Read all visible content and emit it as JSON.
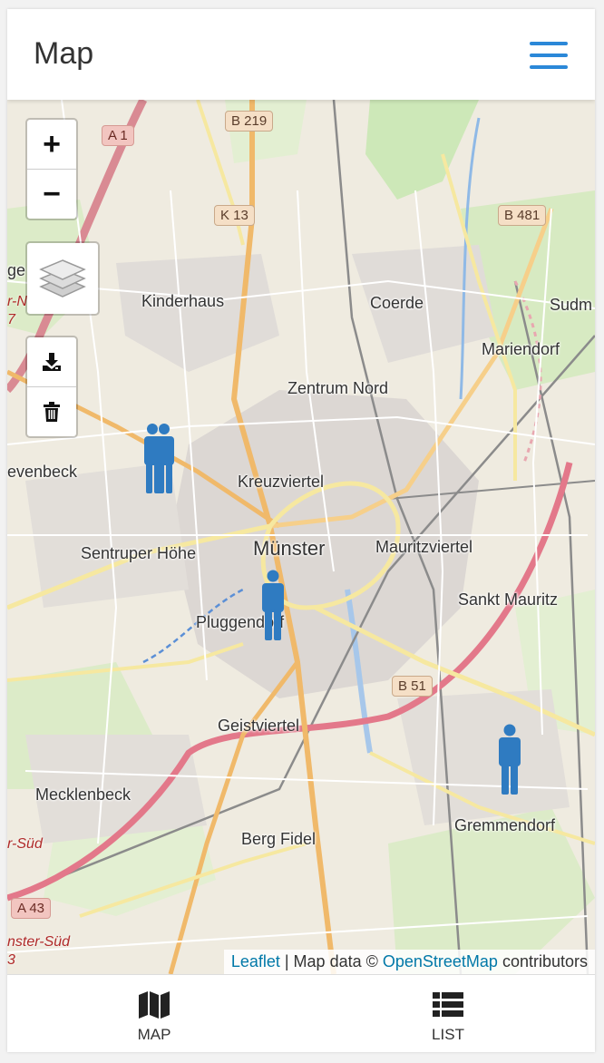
{
  "header": {
    "title": "Map"
  },
  "map": {
    "zoom_in_label": "+",
    "zoom_out_label": "−",
    "places": {
      "kinderhaus": "Kinderhaus",
      "coerde": "Coerde",
      "sudm": "Sudm",
      "mariendorf": "Mariendorf",
      "zentrum_nord": "Zentrum Nord",
      "evenbeck": "evenbeck",
      "kreuzviertel": "Kreuzviertel",
      "sentruper_hoehe": "Sentruper Höhe",
      "muenster": "Münster",
      "mauritzviertel": "Mauritzviertel",
      "sankt_mauritz": "Sankt Mauritz",
      "pluggendorf": "Pluggendorf",
      "geistviertel": "Geistviertel",
      "mecklenbeck": "Mecklenbeck",
      "gremmendorf": "Gremmendorf",
      "berg_fidel": "Berg Fidel",
      "ge": "ge"
    },
    "shields": {
      "b219": "B 219",
      "a1": "A 1",
      "k13": "K 13",
      "b481": "B 481",
      "b51": "B 51",
      "a43": "A 43"
    },
    "road_labels": {
      "sued1": "r-Süd",
      "sued2": "nster-Süd",
      "frag1": "r-N",
      "frag2": "7",
      "frag3": "3"
    },
    "attribution": {
      "leaflet": "Leaflet",
      "separator": " | Map data © ",
      "osm": "OpenStreetMap",
      "suffix": " contributors"
    },
    "marker_color": "#2f7bc1"
  },
  "tabs": [
    {
      "label": "MAP",
      "icon": "map-icon"
    },
    {
      "label": "LIST",
      "icon": "list-icon"
    }
  ]
}
